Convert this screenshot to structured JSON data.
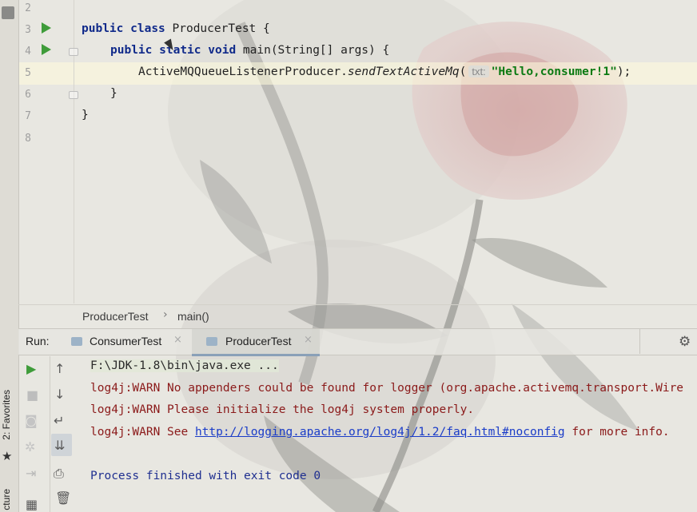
{
  "editor": {
    "lines": [
      {
        "num": "2"
      },
      {
        "num": "3"
      },
      {
        "num": "4"
      },
      {
        "num": "5"
      },
      {
        "num": "6"
      },
      {
        "num": "7"
      },
      {
        "num": "8"
      }
    ],
    "code": {
      "l3_kw1": "public",
      "l3_kw2": "class",
      "l3_rest": "ProducerTest {",
      "l4_kw1": "public",
      "l4_kw2": "static",
      "l4_kw3": "void",
      "l4_rest": "main(String[] args) {",
      "l5_class": "ActiveMQQueueListenerProducer.",
      "l5_method": "sendTextActiveMq",
      "l5_open": "(",
      "l5_hint": "txt:",
      "l5_str": "\"Hello,consumer!1\"",
      "l5_close": ");",
      "l6": "}",
      "l7": "}"
    }
  },
  "breadcrumb": {
    "class": "ProducerTest",
    "sep": "›",
    "method": "main()"
  },
  "run_panel": {
    "label": "Run:",
    "tabs": [
      {
        "label": "ConsumerTest",
        "close": "×"
      },
      {
        "label": "ProducerTest",
        "close": "×"
      }
    ],
    "settings_icon": "gear-icon"
  },
  "left_strip": {
    "favorites": "2: Favorites",
    "structure": "cture"
  },
  "console": {
    "cmd": "F:\\JDK-1.8\\bin\\java.exe ...",
    "warn1": "log4j:WARN No appenders could be found for logger (org.apache.activemq.transport.Wire",
    "warn2": "log4j:WARN Please initialize the log4j system properly.",
    "warn3_pre": "log4j:WARN See ",
    "warn3_link": "http://logging.apache.org/log4j/1.2/faq.html#noconfig",
    "warn3_post": " for more info.",
    "exit": "Process finished with exit code 0"
  },
  "colors": {
    "keyword": "#102a8a",
    "string": "#0b7a12",
    "warn": "#8b1a1a",
    "link": "#1a3cc8",
    "run_green": "#3f9c3a"
  }
}
